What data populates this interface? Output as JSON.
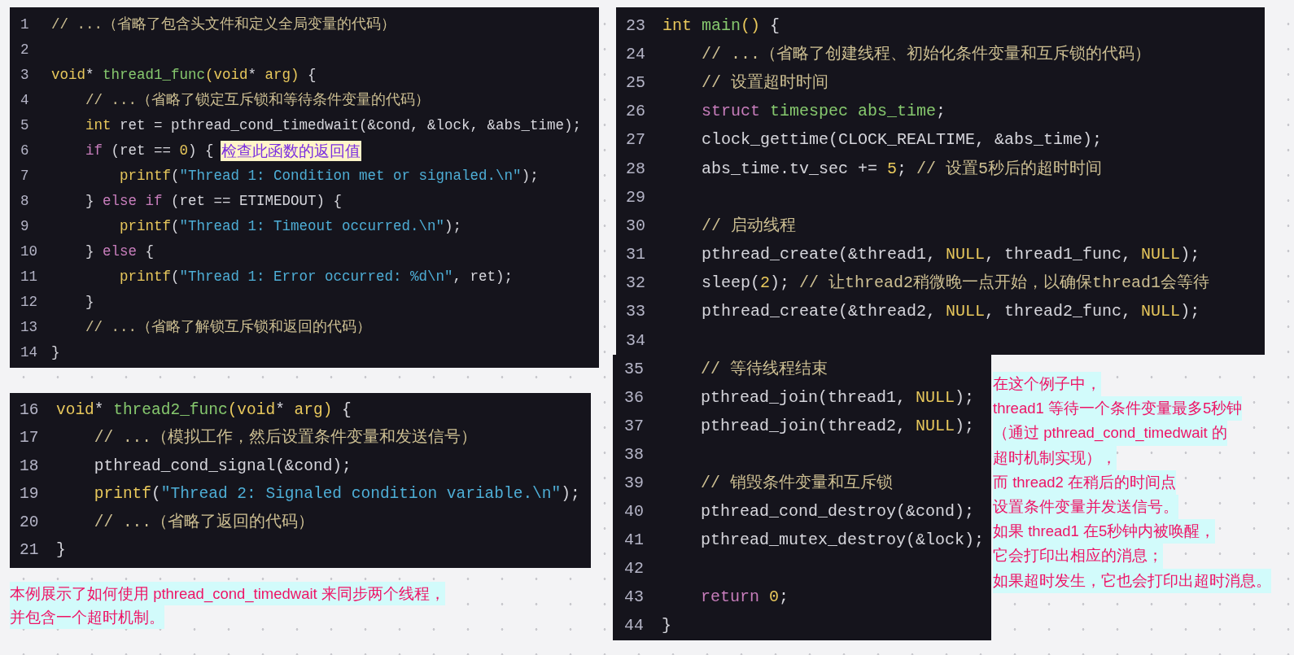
{
  "panels": [
    {
      "lines": [
        {
          "number": "1",
          "tokens": [
            {
              "kind": "comment",
              "text": "// ...（省略了包含头文件和定义全局变量的代码）"
            }
          ]
        },
        {
          "number": "2"
        },
        {
          "number": "3",
          "tokens": [
            {
              "kind": "keyword",
              "text": "void"
            },
            {
              "kind": "plain",
              "text": "* "
            },
            {
              "kind": "function",
              "text": "thread1_func"
            },
            {
              "kind": "keyword",
              "text": "(void"
            },
            {
              "kind": "plain",
              "text": "* "
            },
            {
              "kind": "keyword",
              "text": "arg)"
            },
            {
              "kind": "plain",
              "text": " {"
            }
          ]
        },
        {
          "number": "4",
          "tokens": [
            {
              "kind": "comment",
              "text": "    // ...（省略了锁定互斥锁和等待条件变量的代码）"
            }
          ]
        },
        {
          "number": "5",
          "tokens": [
            {
              "kind": "keyword",
              "text": "    int"
            },
            {
              "kind": "plain",
              "text": " ret = pthread_cond_timedwait(&cond, &lock, &abs_time);"
            }
          ]
        },
        {
          "number": "6",
          "tokens": [
            {
              "kind": "control",
              "text": "    if"
            },
            {
              "kind": "plain",
              "text": " (ret == "
            },
            {
              "kind": "keyword",
              "text": "0"
            },
            {
              "kind": "plain",
              "text": ") {"
            }
          ],
          "note": "检查此函数的返回值"
        },
        {
          "number": "7",
          "tokens": [
            {
              "kind": "keyword",
              "text": "        printf"
            },
            {
              "kind": "plain",
              "text": "("
            },
            {
              "kind": "string",
              "text": "\"Thread 1: Condition met or signaled.\\n\""
            },
            {
              "kind": "plain",
              "text": ");"
            }
          ]
        },
        {
          "number": "8",
          "tokens": [
            {
              "kind": "plain",
              "text": "    } "
            },
            {
              "kind": "control",
              "text": "else if"
            },
            {
              "kind": "plain",
              "text": " (ret == ETIMEDOUT) {"
            }
          ]
        },
        {
          "number": "9",
          "tokens": [
            {
              "kind": "keyword",
              "text": "        printf"
            },
            {
              "kind": "plain",
              "text": "("
            },
            {
              "kind": "string",
              "text": "\"Thread 1: Timeout occurred.\\n\""
            },
            {
              "kind": "plain",
              "text": ");"
            }
          ]
        },
        {
          "number": "10",
          "tokens": [
            {
              "kind": "plain",
              "text": "    } "
            },
            {
              "kind": "control",
              "text": "else"
            },
            {
              "kind": "plain",
              "text": " {"
            }
          ]
        },
        {
          "number": "11",
          "tokens": [
            {
              "kind": "keyword",
              "text": "        printf"
            },
            {
              "kind": "plain",
              "text": "("
            },
            {
              "kind": "string",
              "text": "\"Thread 1: Error occurred: %d\\n\""
            },
            {
              "kind": "plain",
              "text": ", ret);"
            }
          ]
        },
        {
          "number": "12",
          "tokens": [
            {
              "kind": "plain",
              "text": "    }"
            }
          ]
        },
        {
          "number": "13",
          "tokens": [
            {
              "kind": "comment",
              "text": "    // ...（省略了解锁互斥锁和返回的代码）"
            }
          ]
        },
        {
          "number": "14",
          "tokens": [
            {
              "kind": "plain",
              "text": "}"
            }
          ]
        }
      ]
    },
    {
      "lines": [
        {
          "number": "16",
          "tokens": [
            {
              "kind": "keyword",
              "text": "void"
            },
            {
              "kind": "plain",
              "text": "* "
            },
            {
              "kind": "function",
              "text": "thread2_func"
            },
            {
              "kind": "keyword",
              "text": "(void"
            },
            {
              "kind": "plain",
              "text": "* "
            },
            {
              "kind": "keyword",
              "text": "arg)"
            },
            {
              "kind": "plain",
              "text": " {"
            }
          ]
        },
        {
          "number": "17",
          "tokens": [
            {
              "kind": "comment",
              "text": "    // ...（模拟工作，然后设置条件变量和发送信号）"
            }
          ]
        },
        {
          "number": "18",
          "tokens": [
            {
              "kind": "plain",
              "text": "    pthread_cond_signal(&cond);"
            }
          ]
        },
        {
          "number": "19",
          "tokens": [
            {
              "kind": "keyword",
              "text": "    printf"
            },
            {
              "kind": "plain",
              "text": "("
            },
            {
              "kind": "string",
              "text": "\"Thread 2: Signaled condition variable.\\n\""
            },
            {
              "kind": "plain",
              "text": ");"
            }
          ]
        },
        {
          "number": "20",
          "tokens": [
            {
              "kind": "comment",
              "text": "    // ...（省略了返回的代码）"
            }
          ]
        },
        {
          "number": "21",
          "tokens": [
            {
              "kind": "plain",
              "text": "}"
            }
          ]
        }
      ]
    },
    {
      "lines": [
        {
          "number": "23",
          "tokens": [
            {
              "kind": "keyword",
              "text": "int"
            },
            {
              "kind": "function",
              "text": " main"
            },
            {
              "kind": "keyword",
              "text": "()"
            },
            {
              "kind": "plain",
              "text": " {"
            }
          ]
        },
        {
          "number": "24",
          "tokens": [
            {
              "kind": "comment",
              "text": "    // ...（省略了创建线程、初始化条件变量和互斥锁的代码）"
            }
          ]
        },
        {
          "number": "25",
          "tokens": [
            {
              "kind": "comment",
              "text": "    // 设置超时时间"
            }
          ]
        },
        {
          "number": "26",
          "tokens": [
            {
              "kind": "control",
              "text": "    struct"
            },
            {
              "kind": "function",
              "text": " timespec abs_time"
            },
            {
              "kind": "plain",
              "text": ";"
            }
          ]
        },
        {
          "number": "27",
          "tokens": [
            {
              "kind": "plain",
              "text": "    clock_gettime(CLOCK_REALTIME, &abs_time);"
            }
          ]
        },
        {
          "number": "28",
          "tokens": [
            {
              "kind": "plain",
              "text": "    abs_time.tv_sec += "
            },
            {
              "kind": "keyword",
              "text": "5"
            },
            {
              "kind": "plain",
              "text": ";"
            },
            {
              "kind": "comment",
              "text": " // 设置5秒后的超时时间"
            }
          ]
        },
        {
          "number": "29"
        },
        {
          "number": "30",
          "tokens": [
            {
              "kind": "comment",
              "text": "    // 启动线程"
            }
          ]
        },
        {
          "number": "31",
          "tokens": [
            {
              "kind": "plain",
              "text": "    pthread_create(&thread1, "
            },
            {
              "kind": "keyword",
              "text": "NULL"
            },
            {
              "kind": "plain",
              "text": ", thread1_func, "
            },
            {
              "kind": "keyword",
              "text": "NULL"
            },
            {
              "kind": "plain",
              "text": ");"
            }
          ]
        },
        {
          "number": "32",
          "tokens": [
            {
              "kind": "plain",
              "text": "    sleep("
            },
            {
              "kind": "keyword",
              "text": "2"
            },
            {
              "kind": "plain",
              "text": ");"
            },
            {
              "kind": "comment",
              "text": " // 让thread2稍微晚一点开始，以确保thread1会等待"
            }
          ]
        },
        {
          "number": "33",
          "tokens": [
            {
              "kind": "plain",
              "text": "    pthread_create(&thread2, "
            },
            {
              "kind": "keyword",
              "text": "NULL"
            },
            {
              "kind": "plain",
              "text": ", thread2_func, "
            },
            {
              "kind": "keyword",
              "text": "NULL"
            },
            {
              "kind": "plain",
              "text": ");"
            }
          ]
        },
        {
          "number": "34"
        }
      ]
    },
    {
      "lines": [
        {
          "number": "35",
          "tokens": [
            {
              "kind": "comment",
              "text": "    // 等待线程结束"
            }
          ]
        },
        {
          "number": "36",
          "tokens": [
            {
              "kind": "plain",
              "text": "    pthread_join(thread1, "
            },
            {
              "kind": "keyword",
              "text": "NULL"
            },
            {
              "kind": "plain",
              "text": ");"
            }
          ]
        },
        {
          "number": "37",
          "tokens": [
            {
              "kind": "plain",
              "text": "    pthread_join(thread2, "
            },
            {
              "kind": "keyword",
              "text": "NULL"
            },
            {
              "kind": "plain",
              "text": ");"
            }
          ]
        },
        {
          "number": "38"
        },
        {
          "number": "39",
          "tokens": [
            {
              "kind": "comment",
              "text": "    // 销毁条件变量和互斥锁"
            }
          ]
        },
        {
          "number": "40",
          "tokens": [
            {
              "kind": "plain",
              "text": "    pthread_cond_destroy(&cond);"
            }
          ]
        },
        {
          "number": "41",
          "tokens": [
            {
              "kind": "plain",
              "text": "    pthread_mutex_destroy(&lock);"
            }
          ]
        },
        {
          "number": "42"
        },
        {
          "number": "43",
          "tokens": [
            {
              "kind": "control",
              "text": "    return"
            },
            {
              "kind": "keyword",
              "text": " 0"
            },
            {
              "kind": "plain",
              "text": ";"
            }
          ]
        },
        {
          "number": "44",
          "tokens": [
            {
              "kind": "plain",
              "text": "}"
            }
          ]
        }
      ]
    }
  ],
  "caption": [
    "本例展示了如何使用 pthread_cond_timedwait 来同步两个线程，",
    "并包含一个超时机制。"
  ],
  "explanation": [
    "在这个例子中，",
    "thread1 等待一个条件变量最多5秒钟",
    "（通过 pthread_cond_timedwait 的",
    "超时机制实现），",
    "而 thread2 在稍后的时间点",
    "设置条件变量并发送信号。",
    "如果 thread1 在5秒钟内被唤醒，",
    "它会打印出相应的消息；",
    "如果超时发生，它也会打印出超时消息。"
  ]
}
